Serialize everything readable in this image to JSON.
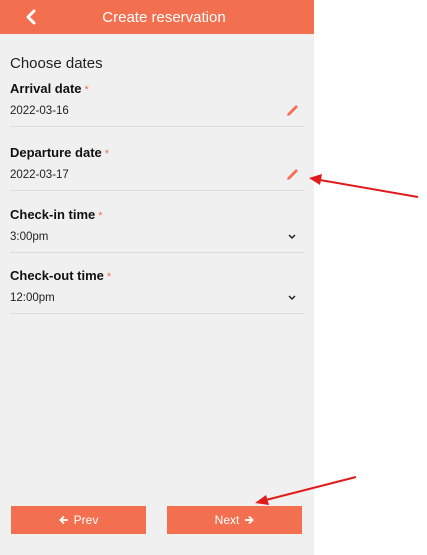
{
  "header": {
    "title": "Create reservation",
    "back_icon": "chevron-left-icon"
  },
  "section": {
    "title": "Choose dates"
  },
  "fields": {
    "arrival": {
      "label": "Arrival date",
      "required": "*",
      "value": "2022-03-16",
      "icon": "pencil-icon"
    },
    "departure": {
      "label": "Departure date",
      "required": "*",
      "value": "2022-03-17",
      "icon": "pencil-icon"
    },
    "checkin": {
      "label": "Check-in time",
      "required": "*",
      "value": "3:00pm",
      "icon": "chevron-down-icon"
    },
    "checkout": {
      "label": "Check-out time",
      "required": "*",
      "value": "12:00pm",
      "icon": "chevron-down-icon"
    }
  },
  "footer": {
    "prev_label": "Prev",
    "prev_icon": "arrow-left-icon",
    "next_label": "Next",
    "next_icon": "arrow-right-icon"
  },
  "colors": {
    "accent": "#f26f4f",
    "annotation": "#e11b1b",
    "panel": "#f0f0f0"
  }
}
